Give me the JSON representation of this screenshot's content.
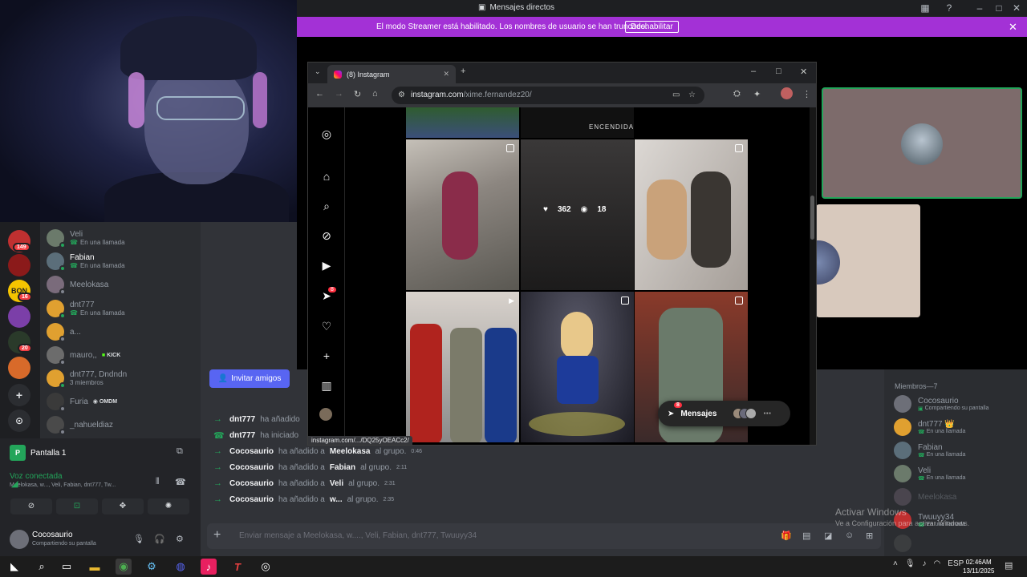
{
  "window": {
    "title": "Mensajes directos"
  },
  "streamer_banner": {
    "text": "El modo Streamer está habilitado. Los nombres de usuario se han truncado.",
    "button": "Deshabilitar"
  },
  "servers": [
    {
      "badge": "149",
      "color": "#c03030"
    },
    {
      "badge": "",
      "color": "#8b1a1a"
    },
    {
      "badge": "16",
      "color": "#f5c400",
      "label": "BON"
    },
    {
      "badge": "",
      "color": "#7b3fa8"
    },
    {
      "badge": "20",
      "color": "#2a3a2a"
    },
    {
      "badge": "",
      "color": "#d86a2a"
    }
  ],
  "dm_list": [
    {
      "name": "Veli",
      "sub": "En una llamada",
      "call": true,
      "color": "#6b7a6b"
    },
    {
      "name": "Fabian",
      "sub": "En una llamada",
      "call": true,
      "color": "#5b6e7a",
      "active": true
    },
    {
      "name": "Meelokasa",
      "sub": "",
      "color": "#7a6b7b"
    },
    {
      "name": "dnt777",
      "sub": "En una llamada",
      "call": true,
      "color": "#e0a030"
    },
    {
      "name": "a...",
      "sub": "",
      "color": "#e0a030"
    },
    {
      "name": "mauro,,",
      "sub": "",
      "tag": "KICK",
      "color": "#6c6c6c"
    },
    {
      "name": "dnt777, Dndndn",
      "sub": "3 miembros",
      "color": "#e0a030"
    },
    {
      "name": "Furia",
      "sub": "",
      "tag": "OMDM",
      "color": "#3a3a3a"
    },
    {
      "name": "_nahueldiaz",
      "sub": "",
      "color": "#4a4a4a"
    }
  ],
  "voice": {
    "stream_label": "Pantalla 1",
    "status": "Voz conectada",
    "members": "Meelokasa, w..., Veli, Fabian, dnt777, Tw..."
  },
  "user": {
    "name": "Cocosaurio",
    "status": "Compartiendo su pantalla"
  },
  "chat": {
    "invite_button": "Invitar amigos",
    "messages": [
      {
        "actor": "dnt777",
        "text": "ha añadido",
        "target": "",
        "suffix": "",
        "time": "",
        "icon": "arrow"
      },
      {
        "actor": "dnt777",
        "text": "ha iniciado",
        "target": "",
        "suffix": "",
        "time": "",
        "icon": "phone"
      },
      {
        "actor": "Cocosaurio",
        "text": "ha añadido a",
        "target": "Meelokasa",
        "suffix": "al grupo.",
        "time": "0:46",
        "icon": "arrow"
      },
      {
        "actor": "Cocosaurio",
        "text": "ha añadido a",
        "target": "Fabian",
        "suffix": "al grupo.",
        "time": "2:11",
        "icon": "arrow"
      },
      {
        "actor": "Cocosaurio",
        "text": "ha añadido a",
        "target": "Veli",
        "suffix": "al grupo.",
        "time": "2:31",
        "icon": "arrow"
      },
      {
        "actor": "Cocosaurio",
        "text": "ha añadido a",
        "target": "w...",
        "suffix": "al grupo.",
        "time": "2:35",
        "icon": "arrow"
      }
    ],
    "input_placeholder": "Enviar mensaje a Meelokasa, w...., Veli, Fabian, dnt777, Twuuyy34"
  },
  "members": {
    "header": "Miembros—7",
    "list": [
      {
        "name": "Cocosaurio",
        "sub": "Compartiendo su pantalla",
        "color": "#6d6f78",
        "icon": "screen"
      },
      {
        "name": "dnt777 👑",
        "sub": "En una llamada",
        "color": "#e0a030",
        "icon": "phone"
      },
      {
        "name": "Fabian",
        "sub": "En una llamada",
        "color": "#5b6e7a",
        "icon": "phone"
      },
      {
        "name": "Veli",
        "sub": "En una llamada",
        "color": "#6b7a6b",
        "icon": "phone"
      },
      {
        "name": "Meelokasa",
        "sub": "",
        "color": "#7a6b7b",
        "offline": true
      },
      {
        "name": "Twuuyy34",
        "sub": "En una llamada",
        "color": "#c03030",
        "icon": "phone"
      },
      {
        "name": "",
        "sub": "",
        "color": "#555",
        "offline": true
      }
    ]
  },
  "activate_windows": {
    "title": "Activar Windows",
    "subtitle": "Ve a Configuración para activar Windows."
  },
  "browser": {
    "tab_title": "(8) Instagram",
    "url_host": "instagram.com",
    "url_path": "/xime.fernandez20/",
    "status_url": "instagram.com/.../DQ25yOEACc2/",
    "ig_notifications": "8",
    "hover_likes": "362",
    "hover_comments": "18",
    "top_caption": "ENCENDIDA",
    "messages_label": "Mensajes",
    "messages_badge": "8"
  },
  "taskbar": {
    "time": "02:46AM",
    "date": "13/11/2025",
    "lang": "ESP"
  }
}
